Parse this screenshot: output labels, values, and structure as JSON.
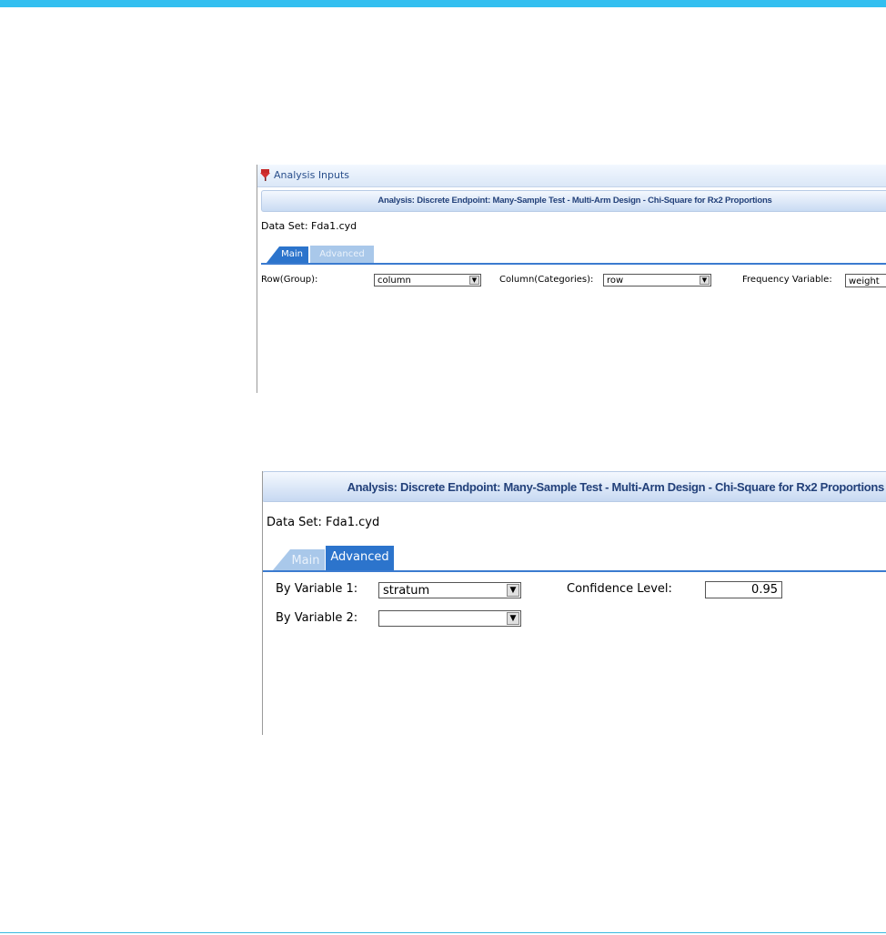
{
  "colors": {
    "accent": "#33bff0",
    "tab_active": "#2c74cc",
    "tab_inactive": "#a9c8ea",
    "header_text": "#23417a"
  },
  "panel1": {
    "title": "Analysis Inputs",
    "title_icon": "pin-icon",
    "header": "Analysis: Discrete Endpoint: Many-Sample Test - Multi-Arm Design - Chi-Square for Rx2 Proportions",
    "dataset": "Data Set: Fda1.cyd",
    "tabs": {
      "main": "Main",
      "advanced": "Advanced",
      "active": "Main"
    },
    "row_group": {
      "label": "Row(Group):",
      "value": "column"
    },
    "column_categories": {
      "label": "Column(Categories):",
      "value": "row"
    },
    "frequency_variable": {
      "label": "Frequency Variable:",
      "value": "weight"
    }
  },
  "panel2": {
    "header": "Analysis: Discrete Endpoint: Many-Sample Test - Multi-Arm Design - Chi-Square for Rx2 Proportions",
    "dataset": "Data Set: Fda1.cyd",
    "tabs": {
      "main": "Main",
      "advanced": "Advanced",
      "active": "Advanced"
    },
    "by_variable_1": {
      "label": "By Variable 1:",
      "value": "stratum"
    },
    "by_variable_2": {
      "label": "By Variable 2:",
      "value": ""
    },
    "confidence_level": {
      "label": "Confidence Level:",
      "value": "0.95"
    }
  },
  "dropdown_glyph": "▼"
}
